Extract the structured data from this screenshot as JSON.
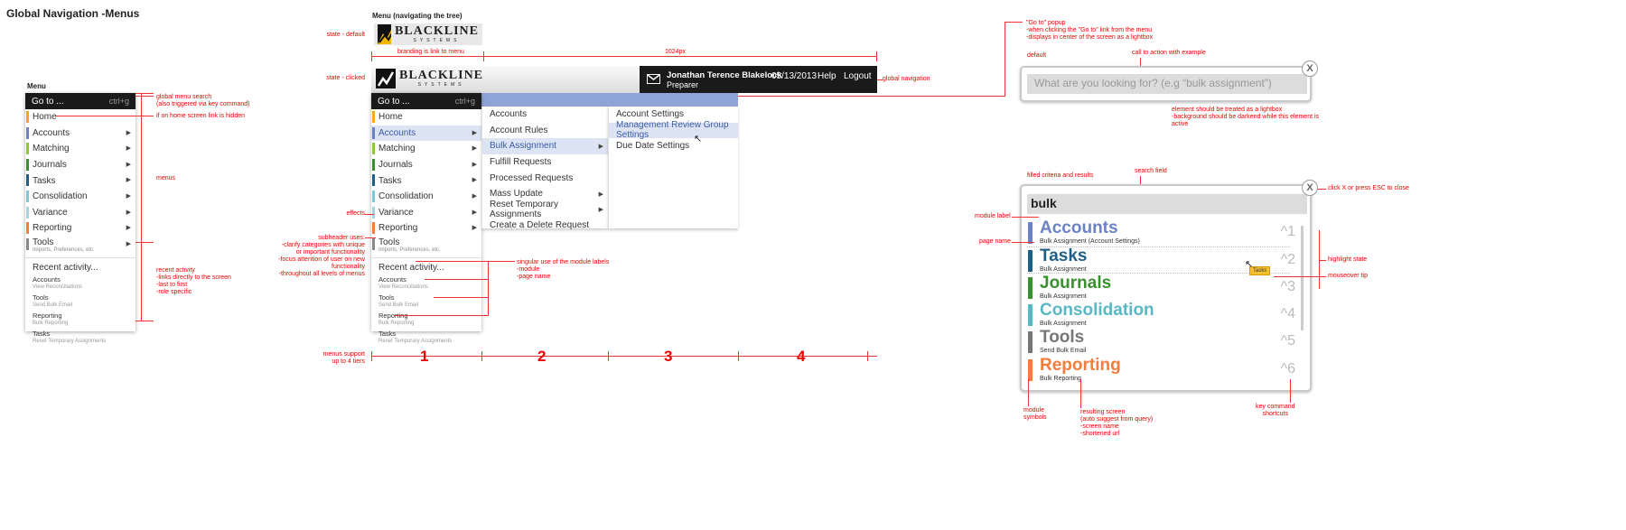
{
  "page_title": "Global Navigation -Menus",
  "left": {
    "heading": "Menu",
    "goto": {
      "label": "Go to ...",
      "shortcut": "ctrl+g"
    },
    "items": [
      {
        "label": "Home",
        "color": "#f5a623",
        "arrow": false
      },
      {
        "label": "Accounts",
        "color": "#6d82c4",
        "arrow": true
      },
      {
        "label": "Matching",
        "color": "#8dc63f",
        "arrow": true
      },
      {
        "label": "Journals",
        "color": "#3a8f2e",
        "arrow": true
      },
      {
        "label": "Tasks",
        "color": "#1f5f86",
        "arrow": true
      },
      {
        "label": "Consolidation",
        "color": "#7cc8d6",
        "arrow": true
      },
      {
        "label": "Variance",
        "color": "#a7d4e4",
        "arrow": true
      },
      {
        "label": "Reporting",
        "color": "#f47c3c",
        "arrow": true
      },
      {
        "label": "Tools",
        "sub": "Imports, Preferences, etc.",
        "color": "#888888",
        "arrow": true
      }
    ],
    "recent_heading": "Recent activity...",
    "recent": [
      {
        "module": "Accounts",
        "page": "View Reconciliations"
      },
      {
        "module": "Tools",
        "page": "Send Bulk Email"
      },
      {
        "module": "Reporting",
        "page": "Bulk Reporting"
      },
      {
        "module": "Tasks",
        "page": "Reset Temporary Assignments"
      }
    ],
    "notes": {
      "search": "global menu search\n(also triggered via key command)",
      "home": "if on home screen link is hidden",
      "menus": "menus",
      "recent": "recent activity\n-links directly to the screen\n-last to first\n-role specific"
    }
  },
  "mid": {
    "heading": "Menu (navigating the tree)",
    "state_default": "state - default",
    "state_clicked": "state - clicked",
    "branding_note": "branding is link to menu",
    "width_note": "1024px",
    "logo": {
      "word": "BLACKLINE",
      "sub": "SYSTEMS"
    },
    "header": {
      "user": "Jonathan Terence Blakelock",
      "role": "Preparer",
      "date": "05/13/2013",
      "help": "Help",
      "logout": "Logout",
      "note": "global navigation"
    },
    "goto": {
      "label": "Go to ...",
      "shortcut": "ctrl+g"
    },
    "items": [
      {
        "label": "Home",
        "color": "#f5a623",
        "arrow": false
      },
      {
        "label": "Accounts",
        "color": "#6d82c4",
        "arrow": true,
        "selected": true
      },
      {
        "label": "Matching",
        "color": "#8dc63f",
        "arrow": true
      },
      {
        "label": "Journals",
        "color": "#3a8f2e",
        "arrow": true
      },
      {
        "label": "Tasks",
        "color": "#1f5f86",
        "arrow": true
      },
      {
        "label": "Consolidation",
        "color": "#7cc8d6",
        "arrow": true
      },
      {
        "label": "Variance",
        "color": "#a7d4e4",
        "arrow": true
      },
      {
        "label": "Reporting",
        "color": "#f47c3c",
        "arrow": true
      },
      {
        "label": "Tools",
        "sub": "Imports, Preferences, etc.",
        "color": "#888888",
        "arrow": false
      }
    ],
    "recent_heading": "Recent activity...",
    "recent": [
      {
        "module": "Accounts",
        "page": "View Reconciliations"
      },
      {
        "module": "Tools",
        "page": "Send Bulk Email"
      },
      {
        "module": "Reporting",
        "page": "Bulk Reporting"
      },
      {
        "module": "Tasks",
        "page": "Reset Temporary Assignments"
      }
    ],
    "col2": [
      {
        "label": "Accounts",
        "arrow": false
      },
      {
        "label": "Account Rules",
        "arrow": false
      },
      {
        "label": "Bulk Assignment",
        "arrow": true,
        "selected": true
      },
      {
        "label": "Fulfill Requests",
        "arrow": false
      },
      {
        "label": "Processed Requests",
        "arrow": false
      },
      {
        "label": "Mass Update",
        "arrow": true
      },
      {
        "label": "Reset Temporary Assignments",
        "arrow": true
      },
      {
        "label": "Create a Delete Request",
        "arrow": false
      }
    ],
    "col3": [
      {
        "label": "Account Settings",
        "selected": false
      },
      {
        "label": "Management Review Group Settings",
        "selected": true
      },
      {
        "label": "Due Date Settings",
        "selected": false
      }
    ],
    "tiers": [
      "1",
      "2",
      "3",
      "4"
    ],
    "notes": {
      "tiers": "menus support\nup to 4 tiers",
      "effects": "effects",
      "subheader": "subheader uses:\n-clarify categories with unique\nor important functionality\n-focus attention of user on new\nfunctionality\n-throughout all levels of menus",
      "singular": "singular use of the module labels\n-module\n-page name"
    }
  },
  "right": {
    "popup_notes": "\"Go to\" popup\n-when clicking the \"Go to\" link from the menu\n-displays in center of the screen as a lightbox",
    "default_label": "default",
    "cta_note": "call to action with example",
    "placeholder": "What are you looking for? (e.g “bulk assignment”)",
    "close": "X",
    "lightbox_note": "element should be treated as a lightbox\n-background should be darkend while this element is\nactive",
    "filled_note": "filled criteria and results",
    "search_field_note": "search field",
    "close_note": "click X or press ESC to close",
    "query": "bulk",
    "results": [
      {
        "module": "Accounts",
        "page": "Bulk Assignment (Account Settings)",
        "color": "#6d82c4",
        "key": "^1"
      },
      {
        "module": "Tasks",
        "page": "Bulk Assignment",
        "color": "#1f5f86",
        "key": "^2"
      },
      {
        "module": "Journals",
        "page": "Bulk Assignment",
        "color": "#3a8f2e",
        "key": "^3"
      },
      {
        "module": "Consolidation",
        "page": "Bulk Assignment",
        "color": "#5ab8c4",
        "key": "^4"
      },
      {
        "module": "Tools",
        "page": "Send Bulk Email",
        "color": "#777777",
        "key": "^5"
      },
      {
        "module": "Reporting",
        "page": "Bulk Reporting",
        "color": "#f47c3c",
        "key": "^6"
      }
    ],
    "tooltip": "Tasks",
    "notes": {
      "module_label": "module label",
      "page_name": "page name",
      "highlight": "highlight state",
      "mouseover": "mouseover tip",
      "symbols": "module\nsymbols",
      "resulting": "resulting screen\n(auto suggest from query)\n-screen name\n-shortened url",
      "keycmd": "key command\nshortcuts"
    }
  }
}
